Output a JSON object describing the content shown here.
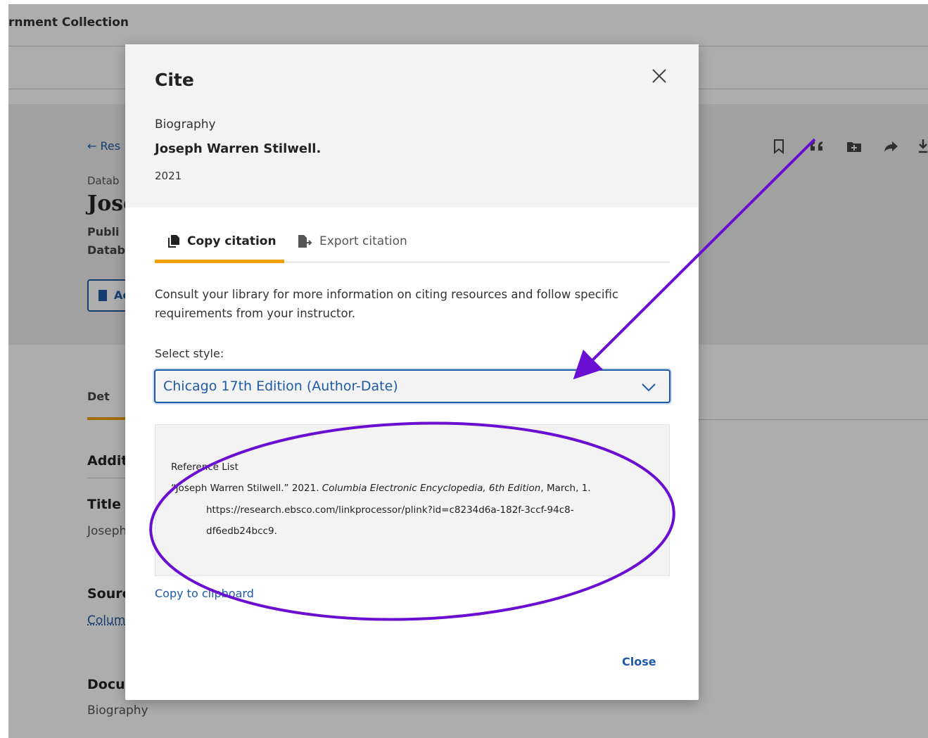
{
  "background": {
    "collection_title": "rnment Collection",
    "back_link": "Res",
    "database_label": "Datab",
    "record_title": "Jose",
    "publication_label": "Publi",
    "database_label_2": "Datab",
    "access_button": "Ac",
    "details_tab": "Det",
    "additional_heading": "Addit",
    "title_heading": "Title",
    "title_value": "Joseph",
    "source_heading": "Sourc",
    "source_value": "Colum",
    "document_heading": "Docu",
    "document_value": "Biography",
    "toolbar_icons": [
      "bookmark-icon",
      "quote-icon",
      "add-to-folder-icon",
      "share-icon",
      "download-icon"
    ]
  },
  "modal": {
    "title": "Cite",
    "close_icon": "close-icon",
    "record": {
      "type": "Biography",
      "title": "Joseph Warren Stilwell.",
      "year": "2021"
    },
    "tabs": [
      {
        "label": "Copy citation",
        "icon": "copy-icon",
        "active": true
      },
      {
        "label": "Export citation",
        "icon": "export-icon",
        "active": false
      }
    ],
    "description": "Consult your library for more information on citing resources and follow specific requirements from your instructor.",
    "style_label": "Select style:",
    "selected_style": "Chicago 17th Edition (Author-Date)",
    "citation": {
      "heading": "Reference List",
      "part1": "“Joseph Warren Stilwell.” 2021. ",
      "source_italic": "Columbia Electronic Encyclopedia, 6th Edition",
      "part2": ", March, 1.",
      "url_line1": "https://research.ebsco.com/linkprocessor/plink?id=c8234d6a-182f-3ccf-94c8-",
      "url_line2": "df6edb24bcc9."
    },
    "copy_link": "Copy to clipboard",
    "close_button": "Close"
  },
  "annotation": {
    "color": "#6a0fd1"
  },
  "colors": {
    "accent": "#1f5aa6",
    "tab_underline": "#f0a000"
  }
}
